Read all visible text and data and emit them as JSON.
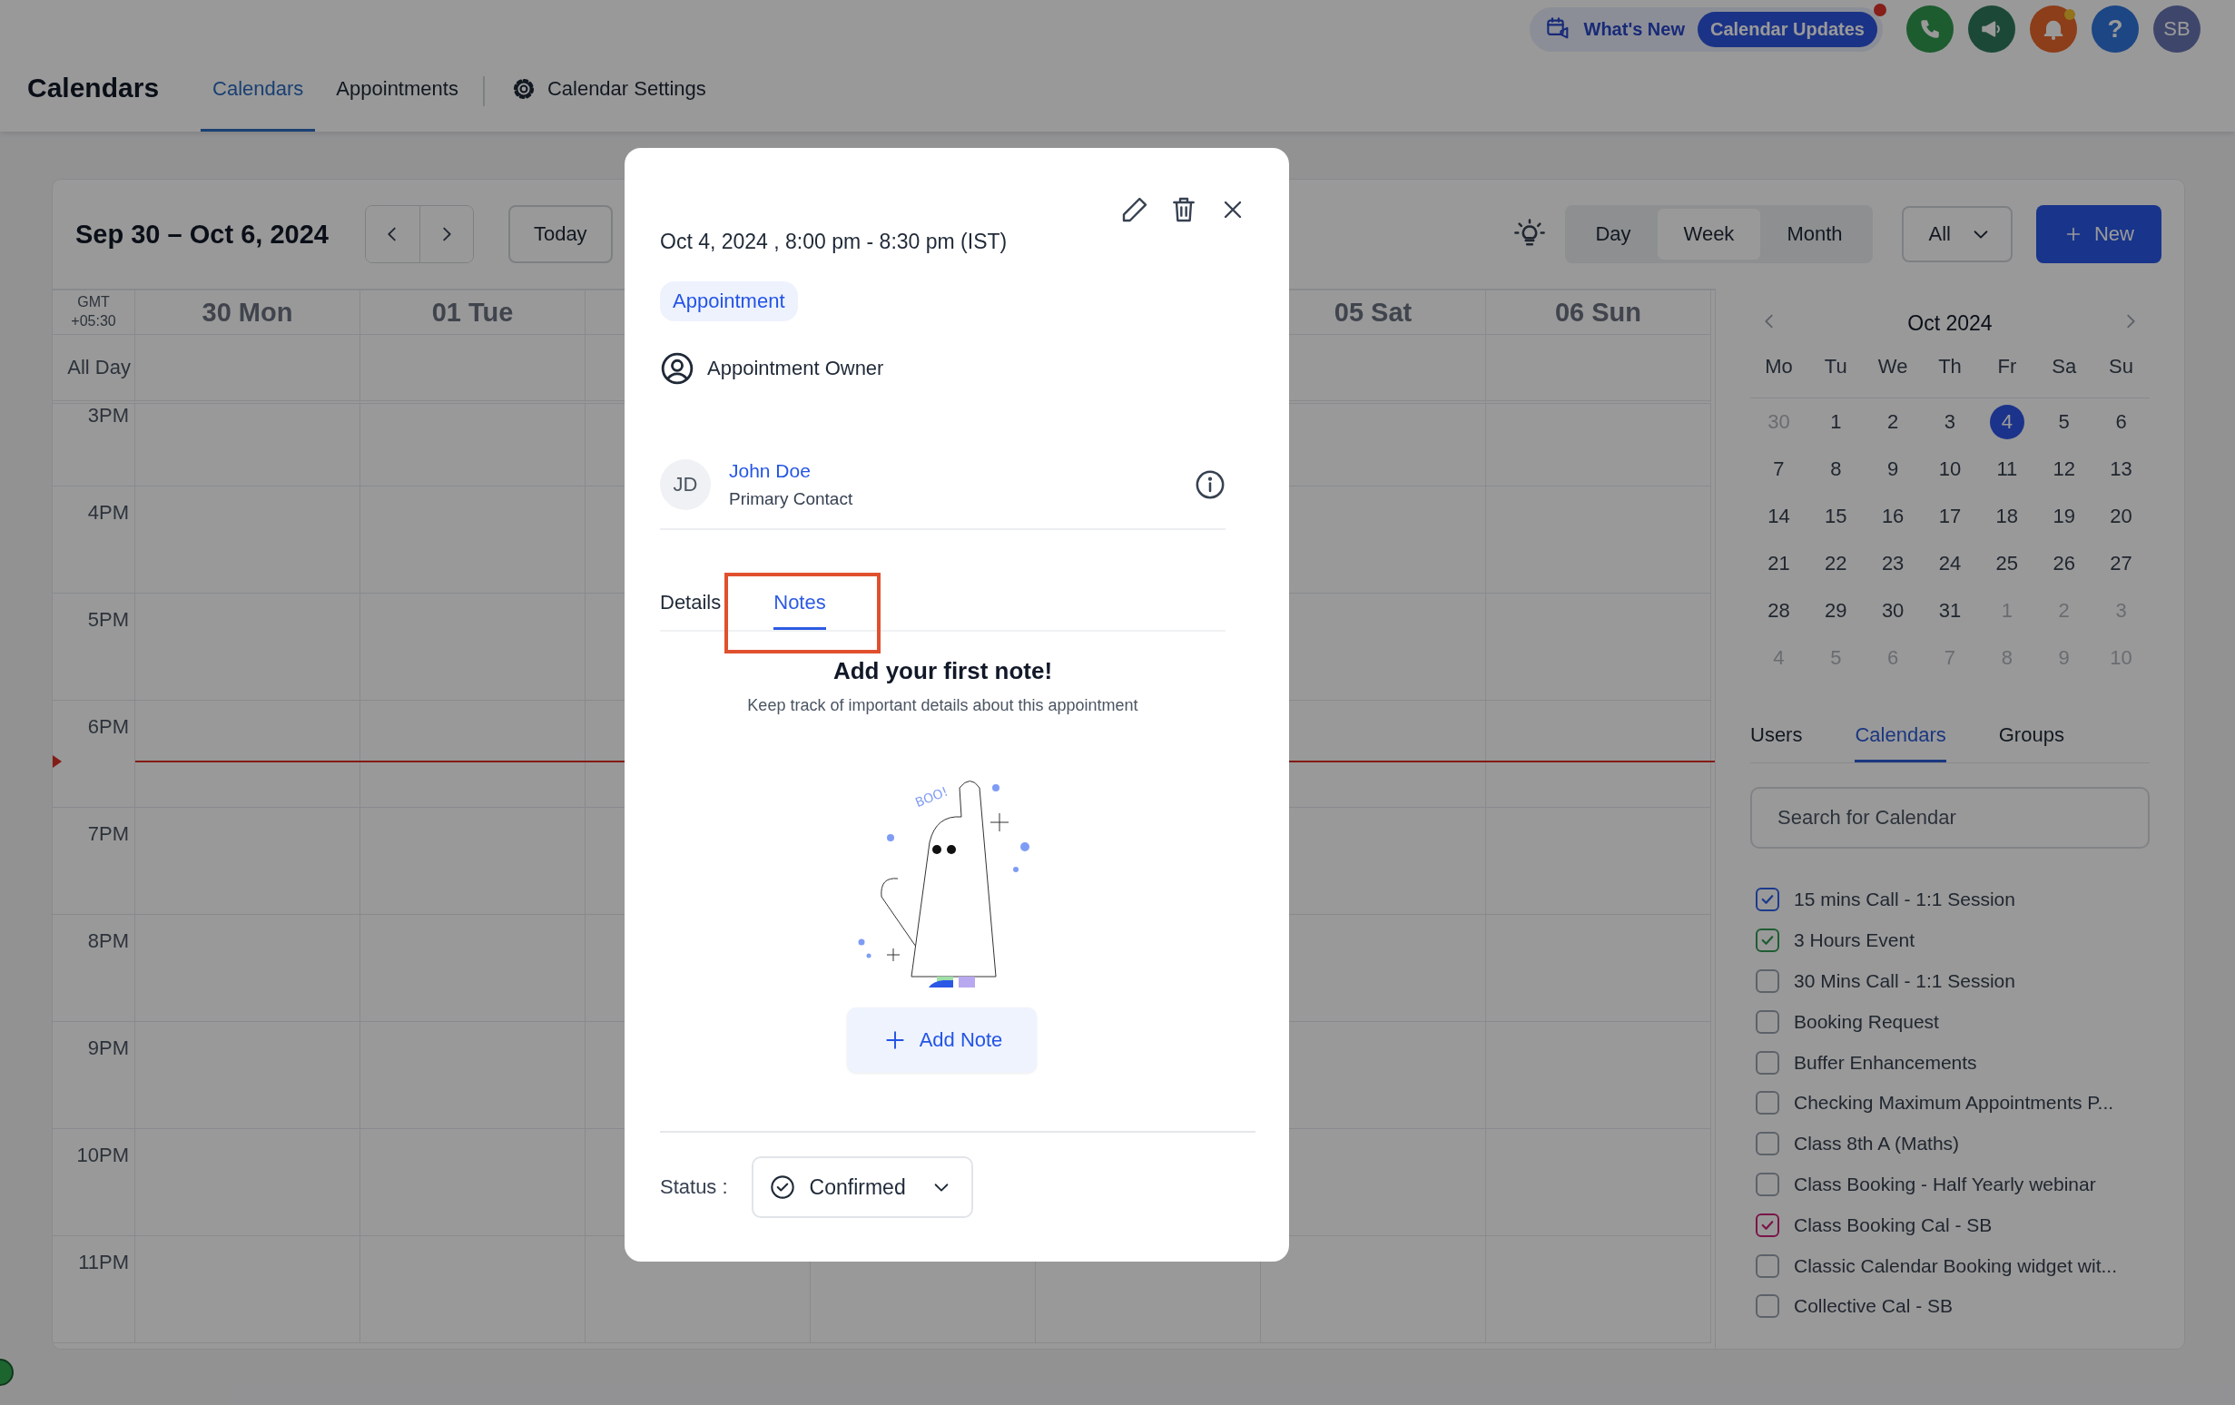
{
  "top_bar": {
    "whats_new": "What's New",
    "updates_badge": "Calendar Updates",
    "help": "?",
    "avatar": "SB"
  },
  "header": {
    "title": "Calendars",
    "tabs": [
      {
        "label": "Calendars",
        "selected": true
      },
      {
        "label": "Appointments",
        "selected": false
      },
      {
        "label": "Calendar Settings",
        "selected": false,
        "kind": "settings"
      }
    ]
  },
  "toolbar": {
    "date_range": "Sep 30 – Oct 6, 2024",
    "today": "Today",
    "views": [
      {
        "label": "Day",
        "selected": false
      },
      {
        "label": "Week",
        "selected": true
      },
      {
        "label": "Month",
        "selected": false
      }
    ],
    "filter": "All",
    "new_button": "New"
  },
  "grid": {
    "timezone": "GMT +05:30",
    "all_day": "All Day",
    "days_left": [
      "30 Mon",
      "01 Tue"
    ],
    "days_right": [
      "05 Sat",
      "06 Sun"
    ],
    "hours": [
      "3PM",
      "4PM",
      "5PM",
      "6PM",
      "7PM",
      "8PM",
      "9PM",
      "10PM",
      "11PM"
    ]
  },
  "mini_calendar": {
    "month": "Oct 2024",
    "weekdays": [
      "Mo",
      "Tu",
      "We",
      "Th",
      "Fr",
      "Sa",
      "Su"
    ],
    "weeks": [
      [
        {
          "day": "30",
          "muted": true,
          "selected": false
        },
        {
          "day": "1",
          "muted": false,
          "selected": false
        },
        {
          "day": "2",
          "muted": false,
          "selected": false
        },
        {
          "day": "3",
          "muted": false,
          "selected": false
        },
        {
          "day": "4",
          "muted": false,
          "selected": true
        },
        {
          "day": "5",
          "muted": false,
          "selected": false
        },
        {
          "day": "6",
          "muted": false,
          "selected": false
        }
      ],
      [
        {
          "day": "7",
          "muted": false,
          "selected": false
        },
        {
          "day": "8",
          "muted": false,
          "selected": false
        },
        {
          "day": "9",
          "muted": false,
          "selected": false
        },
        {
          "day": "10",
          "muted": false,
          "selected": false
        },
        {
          "day": "11",
          "muted": false,
          "selected": false
        },
        {
          "day": "12",
          "muted": false,
          "selected": false
        },
        {
          "day": "13",
          "muted": false,
          "selected": false
        }
      ],
      [
        {
          "day": "14",
          "muted": false,
          "selected": false
        },
        {
          "day": "15",
          "muted": false,
          "selected": false
        },
        {
          "day": "16",
          "muted": false,
          "selected": false
        },
        {
          "day": "17",
          "muted": false,
          "selected": false
        },
        {
          "day": "18",
          "muted": false,
          "selected": false
        },
        {
          "day": "19",
          "muted": false,
          "selected": false
        },
        {
          "day": "20",
          "muted": false,
          "selected": false
        }
      ],
      [
        {
          "day": "21",
          "muted": false,
          "selected": false
        },
        {
          "day": "22",
          "muted": false,
          "selected": false
        },
        {
          "day": "23",
          "muted": false,
          "selected": false
        },
        {
          "day": "24",
          "muted": false,
          "selected": false
        },
        {
          "day": "25",
          "muted": false,
          "selected": false
        },
        {
          "day": "26",
          "muted": false,
          "selected": false
        },
        {
          "day": "27",
          "muted": false,
          "selected": false
        }
      ],
      [
        {
          "day": "28",
          "muted": false,
          "selected": false
        },
        {
          "day": "29",
          "muted": false,
          "selected": false
        },
        {
          "day": "30",
          "muted": false,
          "selected": false
        },
        {
          "day": "31",
          "muted": false,
          "selected": false
        },
        {
          "day": "1",
          "muted": true,
          "selected": false
        },
        {
          "day": "2",
          "muted": true,
          "selected": false
        },
        {
          "day": "3",
          "muted": true,
          "selected": false
        }
      ],
      [
        {
          "day": "4",
          "muted": true,
          "selected": false
        },
        {
          "day": "5",
          "muted": true,
          "selected": false
        },
        {
          "day": "6",
          "muted": true,
          "selected": false
        },
        {
          "day": "7",
          "muted": true,
          "selected": false
        },
        {
          "day": "8",
          "muted": true,
          "selected": false
        },
        {
          "day": "9",
          "muted": true,
          "selected": false
        },
        {
          "day": "10",
          "muted": true,
          "selected": false
        }
      ]
    ]
  },
  "sidebar_tabs": [
    {
      "label": "Users",
      "selected": false
    },
    {
      "label": "Calendars",
      "selected": true
    },
    {
      "label": "Groups",
      "selected": false
    }
  ],
  "search": {
    "placeholder": "Search for Calendar"
  },
  "calendars": [
    {
      "label": "15 mins Call - 1:1 Session",
      "checked": true,
      "color": "#1c3a8c"
    },
    {
      "label": "3 Hours Event",
      "checked": true,
      "color": "#1f5c33"
    },
    {
      "label": "30 Mins Call - 1:1 Session",
      "checked": false
    },
    {
      "label": "Booking Request",
      "checked": false
    },
    {
      "label": "Buffer Enhancements",
      "checked": false
    },
    {
      "label": "Checking Maximum Appointments P...",
      "checked": false
    },
    {
      "label": "Class 8th A (Maths)",
      "checked": false
    },
    {
      "label": "Class Booking - Half Yearly webinar",
      "checked": false
    },
    {
      "label": "Class Booking Cal - SB",
      "checked": true,
      "color": "#7a1548"
    },
    {
      "label": "Classic Calendar Booking widget wit...",
      "checked": false
    },
    {
      "label": "Collective Cal - SB",
      "checked": false
    }
  ],
  "modal": {
    "datetime": "Oct 4, 2024 , 8:00 pm - 8:30 pm (IST)",
    "type_badge": "Appointment",
    "owner": "Appointment Owner",
    "contact": {
      "initials": "JD",
      "name": "John Doe",
      "role": "Primary Contact"
    },
    "tabs": [
      {
        "label": "Details",
        "selected": false,
        "highlighted": false
      },
      {
        "label": "Notes",
        "selected": true,
        "highlighted": true
      }
    ],
    "empty_title": "Add your first note!",
    "empty_text": "Keep track of important details about this appointment",
    "illustration_text": "BOO!",
    "add_button": "Add Note",
    "status_label": "Status :",
    "status_value": "Confirmed"
  }
}
